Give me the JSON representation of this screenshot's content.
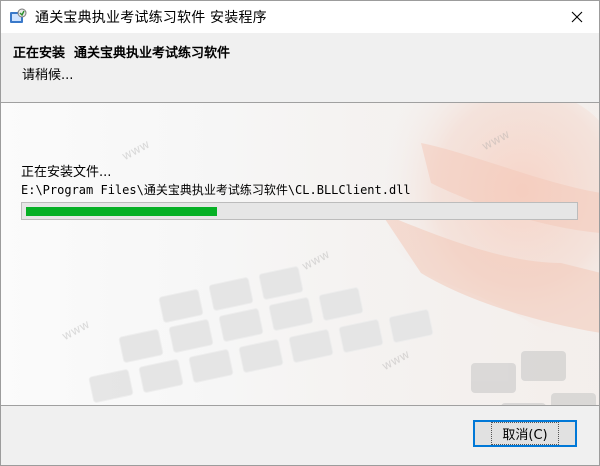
{
  "window": {
    "title": "通关宝典执业考试练习软件 安装程序",
    "icon": "installer-icon",
    "close_icon": "close-icon"
  },
  "header": {
    "title": "正在安装  通关宝典执业考试练习软件",
    "subtitle": "请稍候..."
  },
  "install": {
    "status": "正在安装文件...",
    "current_file": "E:\\Program Files\\通关宝典执业考试练习软件\\CL.BLLClient.dll",
    "progress_fraction": 0.35,
    "progress_color": "#06b025"
  },
  "footer": {
    "cancel_label": "取消(C)",
    "cancel_focus_color": "#0078d7"
  }
}
